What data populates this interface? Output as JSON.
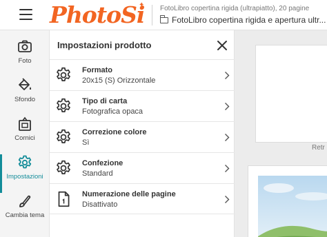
{
  "header": {
    "logo_text": "PhotoSi",
    "product_subtitle": "FotoLibro copertina rigida (ultrapiatto), 20 pagine",
    "product_title": "FotoLibro copertina rigida e apertura ultr..."
  },
  "rail": {
    "items": [
      {
        "label": "Foto",
        "icon": "camera-icon"
      },
      {
        "label": "Sfondo",
        "icon": "paint-bucket-icon"
      },
      {
        "label": "Cornici",
        "icon": "frame-icon"
      },
      {
        "label": "Impostazioni",
        "icon": "gear-icon",
        "active": true
      },
      {
        "label": "Cambia tema",
        "icon": "brush-icon"
      }
    ]
  },
  "panel": {
    "title": "Impostazioni prodotto",
    "rows": [
      {
        "title": "Formato",
        "value": "20x15 (S) Orizzontale",
        "icon": "gear-icon"
      },
      {
        "title": "Tipo di carta",
        "value": "Fotografica opaca",
        "icon": "gear-icon"
      },
      {
        "title": "Correzione colore",
        "value": "Sì",
        "icon": "gear-icon"
      },
      {
        "title": "Confezione",
        "value": "Standard",
        "icon": "gear-icon"
      },
      {
        "title": "Numerazione delle pagine",
        "value": "Disattivato",
        "icon": "page-number-icon"
      }
    ]
  },
  "canvas": {
    "page_label": "Retr"
  },
  "colors": {
    "brand": "#f26522",
    "accent": "#138c99"
  }
}
